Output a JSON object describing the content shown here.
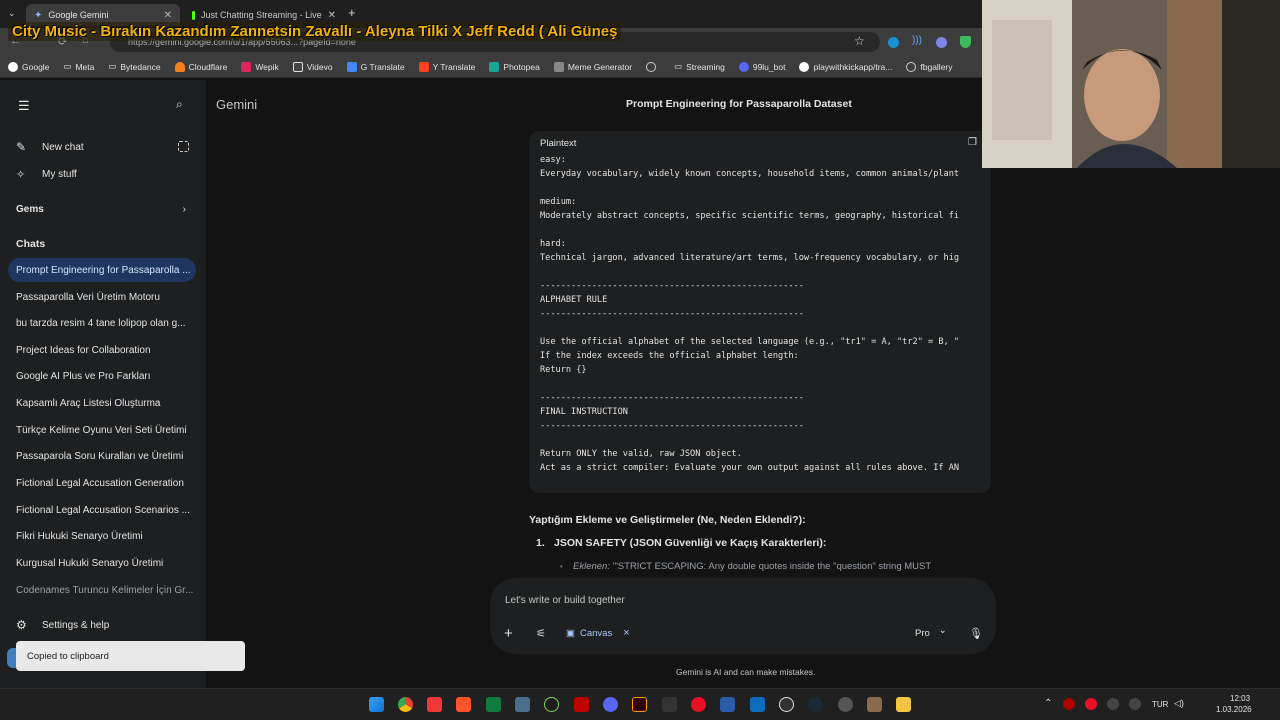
{
  "browser": {
    "tabs": [
      {
        "label": "Google Gemini",
        "active": true
      },
      {
        "label": "Just Chatting Streaming - Live"
      }
    ],
    "new_tab_symbol": "+",
    "url": "https://gemini.google.com/u/1/app/55063...?pageId=none",
    "overlay_title": "City Music - Bırakın Kazandım Zannetsin Zavallı - Aleyna Tilki X Jeff Redd ( Ali Güneş",
    "bookmarks": [
      "Google",
      "Meta",
      "Bytedance",
      "Cloudflare",
      "Wepik",
      "Videvo",
      "G Translate",
      "Y Translate",
      "Photopea",
      "Meme Generator",
      "",
      "Streaming",
      "99lu_bot",
      "playwithkickapp/tra...",
      "fbgallery"
    ]
  },
  "sidebar": {
    "app_name": "Gemini",
    "new_chat": "New chat",
    "my_stuff": "My stuff",
    "gems": "Gems",
    "chats_heading": "Chats",
    "chats": [
      "Prompt Engineering for Passaparolla ...",
      "Passaparolla Veri Üretim Motoru",
      "bu tarzda resim 4 tane lolipop olan g...",
      "Project Ideas for Collaboration",
      "Google AI Plus ve Pro Farkları",
      "Kapsamlı Araç Listesi Oluşturma",
      "Türkçe Kelime Oyunu Veri Seti Üretimi",
      "Passaparola Soru Kuralları ve Üretimi",
      "Fictional Legal Accusation Generation",
      "Fictional Legal Accusation Scenarios ...",
      "Fikri Hukuki Senaryo Üretimi",
      "Kurgusal Hukuki Senaryo Üretimi",
      "Codenames Turuncu Kelimeler İçin Gr..."
    ],
    "settings": "Settings & help"
  },
  "main": {
    "conversation_title": "Prompt Engineering for Passaparolla Dataset",
    "code_lang": "Plaintext",
    "code_lines": [
      "easy:",
      "Everyday vocabulary, widely known concepts, household items, common animals/plant",
      "",
      "medium:",
      "Moderately abstract concepts, specific scientific terms, geography, historical fi",
      "",
      "hard:",
      "Technical jargon, advanced literature/art terms, low-frequency vocabulary, or hig",
      "",
      "---------------------------------------------------",
      "ALPHABET RULE",
      "---------------------------------------------------",
      "",
      "Use the official alphabet of the selected language (e.g., \"tr1\" = A, \"tr2\" = B, \"",
      "If the index exceeds the official alphabet length:",
      "Return {}",
      "",
      "---------------------------------------------------",
      "FINAL INSTRUCTION",
      "---------------------------------------------------",
      "",
      "Return ONLY the valid, raw JSON object.",
      "Act as a strict compiler: Evaluate your own output against all rules above. If AN"
    ],
    "section_heading": "Yaptığım Ekleme ve Geliştirmeler (Ne, Neden Eklendi?):",
    "list_item_number": "1.",
    "list_item_title": "JSON SAFETY (JSON Güvenliği ve Kaçış Karakterleri):",
    "bullet_label": "Eklenen:",
    "bullet_text": " '\"STRICT ESCAPING: Any double quotes inside the \"question\" string MUST"
  },
  "composer": {
    "placeholder": "Let's write or build together",
    "canvas_label": "Canvas",
    "canvas_close": "×",
    "mode": "Pro",
    "add_symbol": "+",
    "mode_chevron": "⌄"
  },
  "footer": {
    "disclaimer": "Gemini is AI and can make mistakes."
  },
  "toast": {
    "text": "Copied to clipboard"
  },
  "taskbar": {
    "lang": "TUR",
    "time": "12:03",
    "date": "1.03.2026"
  },
  "colors": {
    "accent": "#1f3760",
    "link_blue": "#a8c7fa",
    "background": "#131314",
    "overlay_text": "#f5b400"
  }
}
